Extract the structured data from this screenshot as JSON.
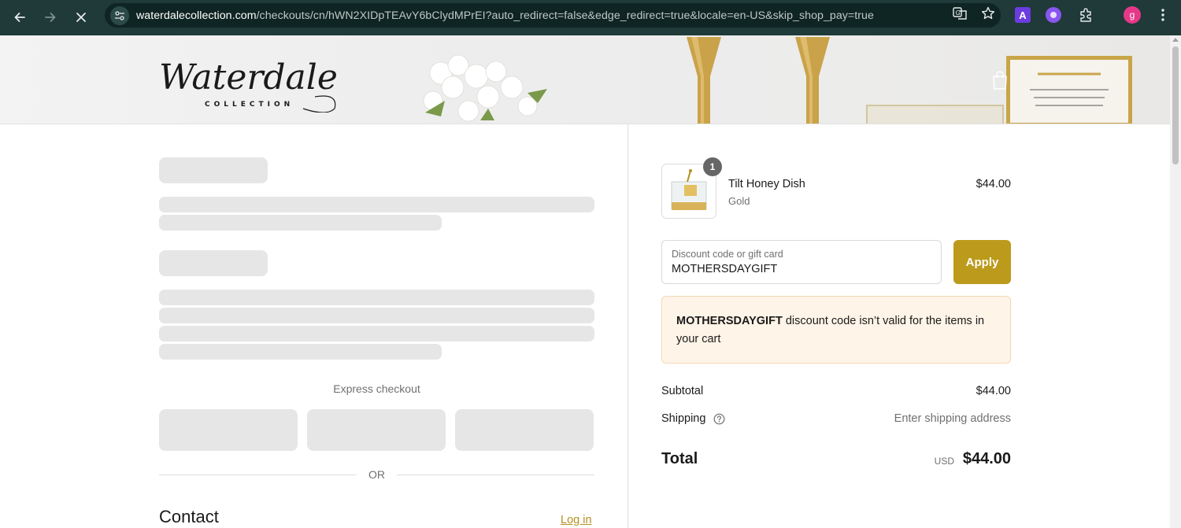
{
  "browser": {
    "url_host": "waterdalecollection.com",
    "url_path": "/checkouts/cn/hWN2XIDpTEAvY6bClydMPrEI?auto_redirect=false&edge_redirect=true&locale=en-US&skip_shop_pay=true",
    "extension_a_label": "A",
    "profile_initial": "g"
  },
  "header": {
    "logo_text": "Waterdale",
    "logo_subtext": "COLLECTION"
  },
  "checkout": {
    "express_checkout_label": "Express checkout",
    "or_label": "OR",
    "contact_heading": "Contact",
    "login_link": "Log in"
  },
  "order_summary": {
    "items": [
      {
        "name": "Tilt Honey Dish",
        "variant": "Gold",
        "price": "$44.00",
        "quantity": "1"
      }
    ],
    "discount": {
      "label": "Discount code or gift card",
      "value": "MOTHERSDAYGIFT",
      "apply_label": "Apply"
    },
    "alert": {
      "code": "MOTHERSDAYGIFT",
      "message": " discount code isn’t valid for the items in your cart"
    },
    "subtotal_label": "Subtotal",
    "subtotal_value": "$44.00",
    "shipping_label": "Shipping",
    "shipping_value": "Enter shipping address",
    "total_label": "Total",
    "currency": "USD",
    "total_value": "$44.00"
  },
  "colors": {
    "accent": "#bc9a1c",
    "alert_bg": "#fff4e8",
    "chrome_bg": "#1f3a38"
  }
}
